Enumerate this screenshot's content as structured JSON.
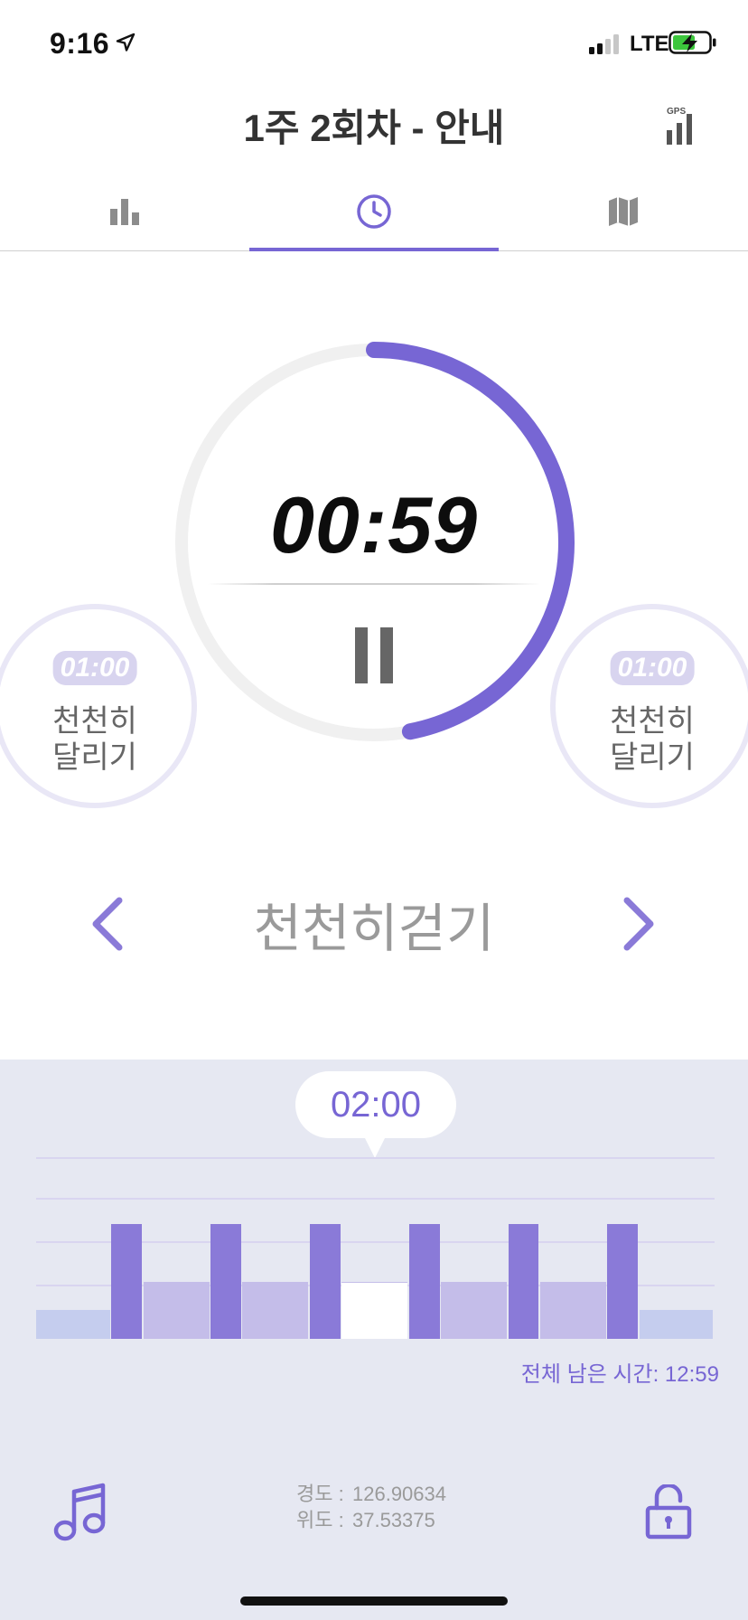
{
  "status_bar": {
    "time": "9:16",
    "network": "LTE",
    "location_icon": "location-arrow-icon",
    "signal_icon": "cellular-signal-icon",
    "battery_icon": "battery-charging-icon"
  },
  "header": {
    "title": "1주 2회차 - 안내",
    "gps_label": "GPS"
  },
  "tabs": [
    {
      "icon": "bar-chart-icon",
      "selected": false
    },
    {
      "icon": "clock-icon",
      "selected": true
    },
    {
      "icon": "map-icon",
      "selected": false
    }
  ],
  "timer": {
    "value": "00:59",
    "progress_fraction": 0.47,
    "pause_icon": "pause-icon"
  },
  "prev_step": {
    "time": "01:00",
    "label_line1": "천천히",
    "label_line2": "달리기"
  },
  "next_step": {
    "time": "01:00",
    "label_line1": "천천히",
    "label_line2": "달리기"
  },
  "current_step": {
    "name": "천천히걷기"
  },
  "chart": {
    "bubble_value": "02:00",
    "remaining_text": "전체 남은 시간: 12:59",
    "segments": [
      {
        "kind": "warmup",
        "level": 0.25,
        "duration": 4.7,
        "color": "#c5cdee"
      },
      {
        "kind": "run",
        "level": 1.0,
        "duration": 2.0,
        "color": "#8a7ad8"
      },
      {
        "kind": "walk",
        "level": 0.5,
        "duration": 4.2,
        "color": "#c4bde9"
      },
      {
        "kind": "run",
        "level": 1.0,
        "duration": 2.0,
        "color": "#8a7ad8"
      },
      {
        "kind": "walk",
        "level": 0.5,
        "duration": 4.2,
        "color": "#c4bde9"
      },
      {
        "kind": "run",
        "level": 1.0,
        "duration": 2.0,
        "color": "#8a7ad8"
      },
      {
        "kind": "walk-current",
        "level": 0.5,
        "duration": 4.2,
        "color": "#ffffff"
      },
      {
        "kind": "run",
        "level": 1.0,
        "duration": 2.0,
        "color": "#8a7ad8"
      },
      {
        "kind": "walk",
        "level": 0.5,
        "duration": 4.2,
        "color": "#c4bde9"
      },
      {
        "kind": "run",
        "level": 1.0,
        "duration": 2.0,
        "color": "#8a7ad8"
      },
      {
        "kind": "walk",
        "level": 0.5,
        "duration": 4.2,
        "color": "#c4bde9"
      },
      {
        "kind": "run",
        "level": 1.0,
        "duration": 2.0,
        "color": "#8a7ad8"
      },
      {
        "kind": "cooldown",
        "level": 0.25,
        "duration": 4.7,
        "color": "#c5cdee"
      }
    ]
  },
  "location": {
    "longitude_label": "경도 :",
    "longitude": "126.90634",
    "latitude_label": "위도 :",
    "latitude": "37.53375"
  },
  "controls": {
    "music_icon": "music-note-icon",
    "lock_icon": "unlocked-padlock-icon"
  },
  "colors": {
    "accent": "#7766d4",
    "ring_track": "#f0f0f0",
    "panel_bg": "#e6e8f2"
  }
}
